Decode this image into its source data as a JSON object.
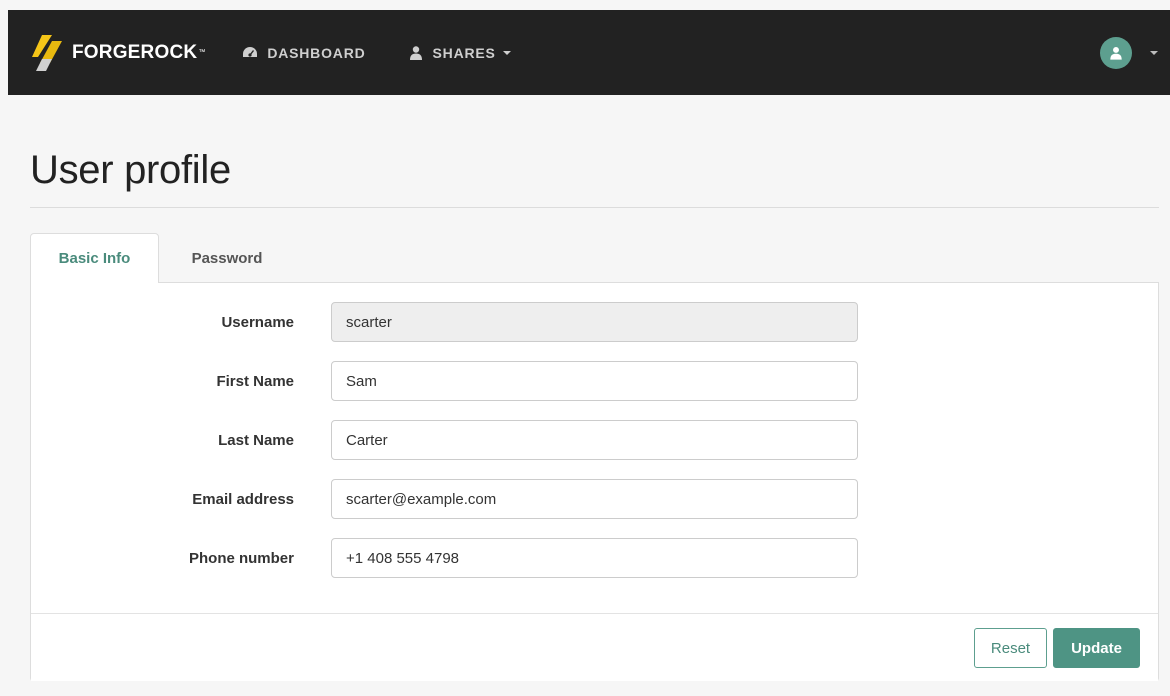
{
  "navbar": {
    "brand": "FORGEROCK",
    "brand_mark": "™",
    "items": [
      {
        "label": "DASHBOARD",
        "icon": "dashboard-icon"
      },
      {
        "label": "SHARES",
        "icon": "user-icon",
        "has_dropdown": true
      }
    ],
    "user_menu": {
      "icon": "user-avatar-icon",
      "has_dropdown": true
    }
  },
  "page": {
    "title": "User profile"
  },
  "tabs": [
    {
      "label": "Basic Info",
      "active": true
    },
    {
      "label": "Password",
      "active": false
    }
  ],
  "form": {
    "fields": [
      {
        "label": "Username",
        "value": "scarter",
        "readonly": true
      },
      {
        "label": "First Name",
        "value": "Sam",
        "readonly": false
      },
      {
        "label": "Last Name",
        "value": "Carter",
        "readonly": false
      },
      {
        "label": "Email address",
        "value": "scarter@example.com",
        "readonly": false
      },
      {
        "label": "Phone number",
        "value": "+1 408 555 4798",
        "readonly": false
      }
    ]
  },
  "actions": {
    "reset_label": "Reset",
    "update_label": "Update"
  },
  "colors": {
    "navbar_bg": "#222222",
    "accent": "#4e9484",
    "page_bg": "#f6f6f6"
  }
}
